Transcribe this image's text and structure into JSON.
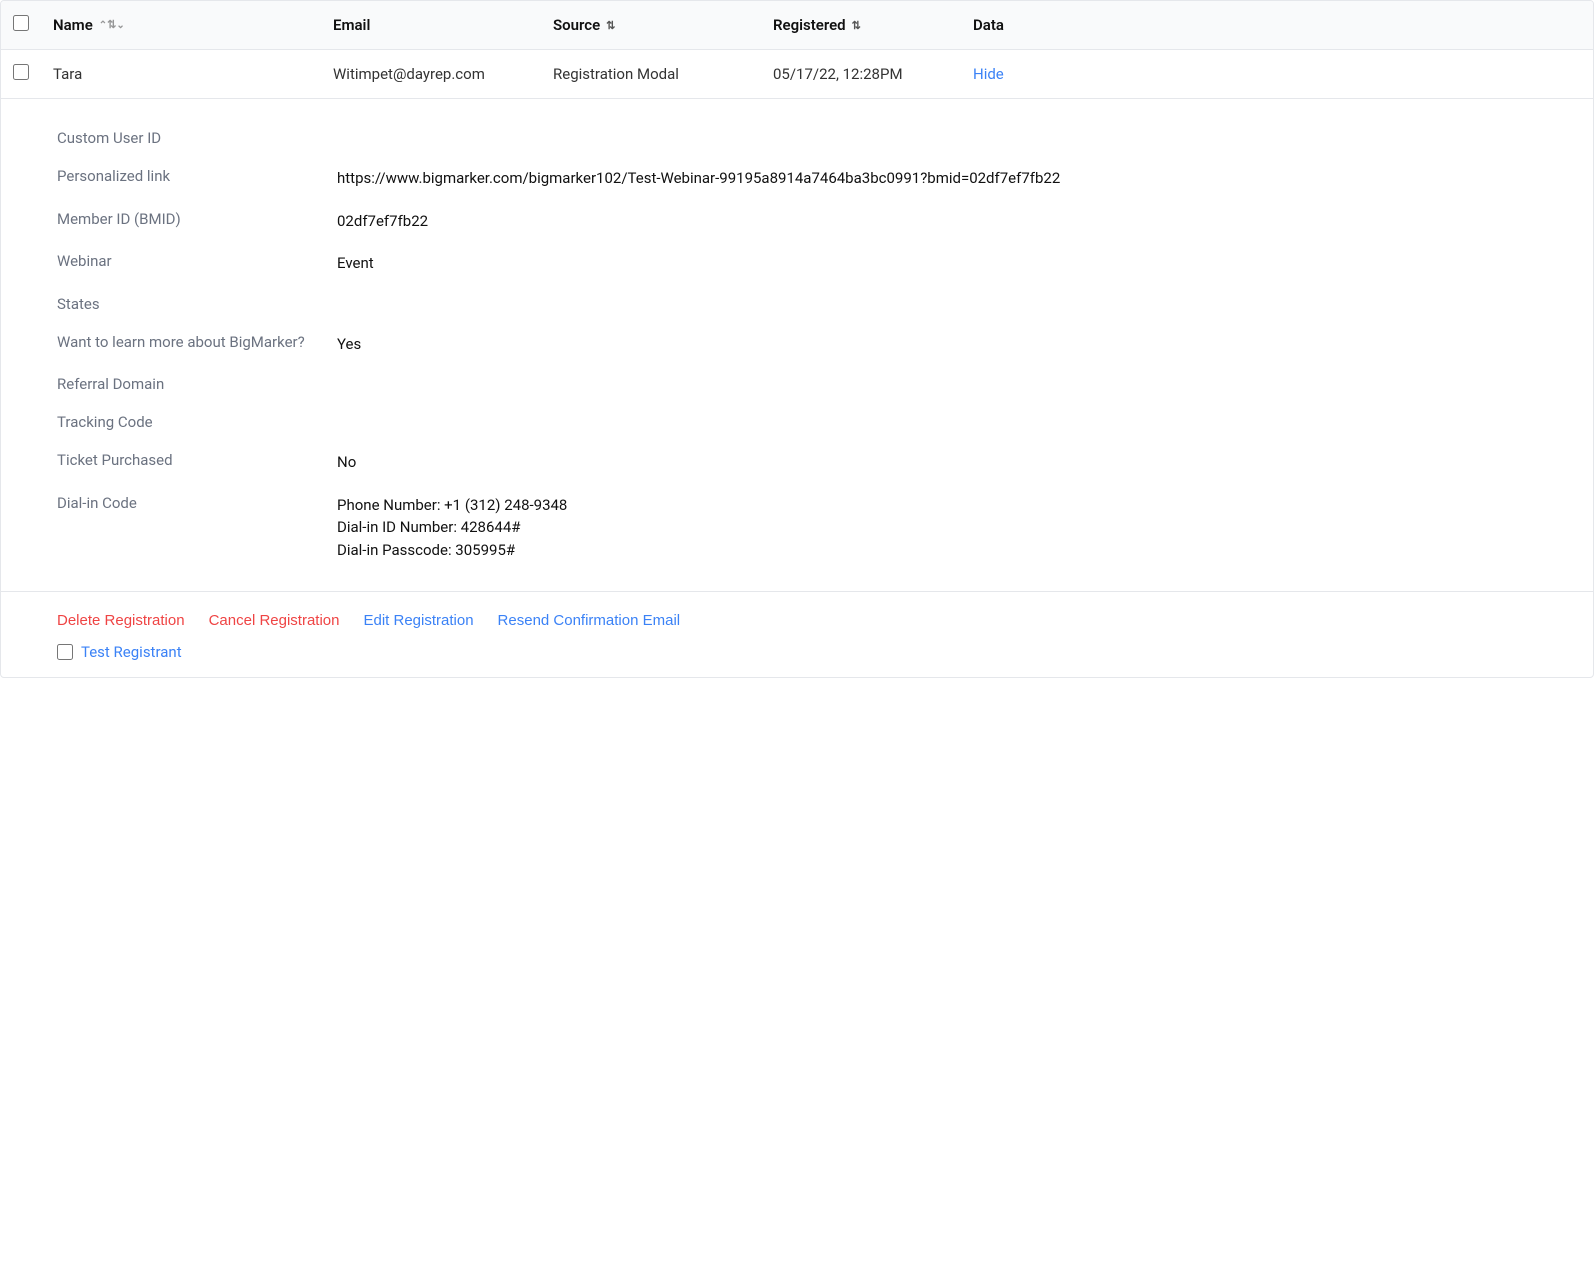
{
  "header": {
    "checkbox_label": "select-all",
    "columns": [
      {
        "id": "name",
        "label": "Name",
        "sortable": true
      },
      {
        "id": "email",
        "label": "Email",
        "sortable": false
      },
      {
        "id": "source",
        "label": "Source",
        "sortable": true
      },
      {
        "id": "registered",
        "label": "Registered",
        "sortable": true
      },
      {
        "id": "data",
        "label": "Data",
        "sortable": false
      }
    ]
  },
  "row": {
    "name": "Tara",
    "email": "Witimpet@dayrep.com",
    "source": "Registration Modal",
    "registered": "05/17/22, 12:28PM",
    "hide_label": "Hide"
  },
  "detail": {
    "fields": [
      {
        "label": "Custom User ID",
        "value": ""
      },
      {
        "label": "Personalized link",
        "value": "https://www.bigmarker.com/bigmarker102/Test-Webinar-99195a8914a7464ba3bc0991?bmid=02df7ef7fb22"
      },
      {
        "label": "Member ID (BMID)",
        "value": "02df7ef7fb22"
      },
      {
        "label": "Webinar",
        "value": "Event"
      },
      {
        "label": "States",
        "value": ""
      },
      {
        "label": "Want to learn more about BigMarker?",
        "value": "Yes"
      },
      {
        "label": "Referral Domain",
        "value": ""
      },
      {
        "label": "Tracking Code",
        "value": ""
      },
      {
        "label": "Ticket Purchased",
        "value": "No"
      },
      {
        "label": "Dial-in Code",
        "value": "Phone Number: +1 (312) 248-9348\nDial-in ID Number: 428644#\nDial-in Passcode: 305995#"
      }
    ]
  },
  "actions": {
    "delete_label": "Delete Registration",
    "cancel_label": "Cancel Registration",
    "edit_label": "Edit Registration",
    "resend_label": "Resend Confirmation Email",
    "test_registrant_label": "Test Registrant"
  }
}
